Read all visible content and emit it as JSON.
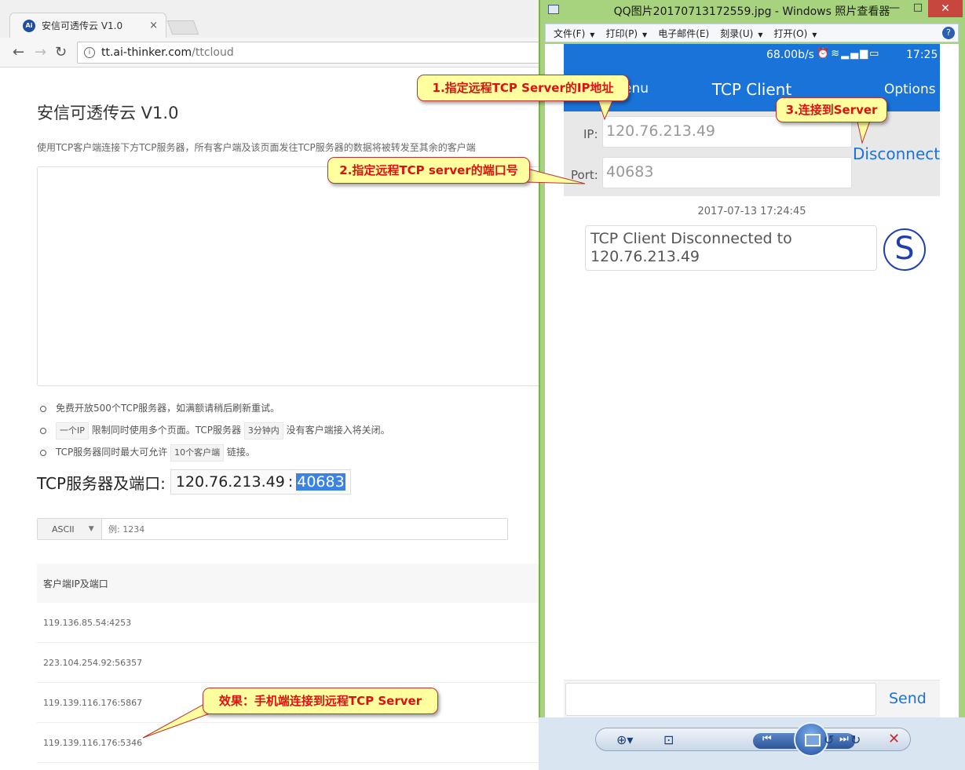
{
  "browser": {
    "tab_title": "安信可透传云 V1.0",
    "tab_icon": "ai-thinker-logo",
    "tab_close": "×",
    "url_domain": "tt.ai-thinker.com",
    "url_path": "/ttcloud"
  },
  "page": {
    "title": "安信可透传云 V1.0",
    "description": "使用TCP客户端连接下方TCP服务器，所有客户端及该页面发往TCP服务器的数据将被转发至其余的客户端",
    "notes": [
      {
        "text": "免费开放500个TCP服务器，如满额请稍后刷新重试。"
      },
      {
        "pre": "",
        "code1": "一个IP",
        "mid": "限制同时使用多个页面。TCP服务器",
        "code2": "3分钟内",
        "post": "没有客户端接入将关闭。"
      },
      {
        "pre": "TCP服务器同时最大可允许",
        "code1": "10个客户端",
        "post": "链接。"
      }
    ],
    "server_label": "TCP服务器及端口:",
    "server_ip": "120.76.213.49",
    "server_sep": ":",
    "server_port": "40683",
    "mode_select": "ASCII",
    "send_placeholder": "例: 1234",
    "table_header": "客户端IP及端口",
    "clients": [
      "119.136.85.54:4253",
      "223.104.254.92:56357",
      "119.139.116.176:5867",
      "119.139.116.176:5346"
    ]
  },
  "viewer": {
    "window_title": "QQ图片20170713172559.jpg - Windows 照片查看器",
    "menu": [
      {
        "label": "文件(F)",
        "caret": true
      },
      {
        "label": "打印(P)",
        "caret": true
      },
      {
        "label": "电子邮件(E)",
        "caret": false
      },
      {
        "label": "刻录(U)",
        "caret": true
      },
      {
        "label": "打开(O)",
        "caret": true
      }
    ],
    "help": "?"
  },
  "phone": {
    "net_speed": "68.00b/s",
    "time": "17:25",
    "menu_label": "enu",
    "app_title": "TCP Client",
    "options_label": "Options",
    "ip_label": "IP:",
    "ip_value": "120.76.213.49",
    "port_label": "Port:",
    "port_value": "40683",
    "connect_button": "Disconnect",
    "chat_date": "2017-07-13 17:24:45",
    "message": "TCP Client Disconnected to 120.76.213.49",
    "avatar_letter": "S",
    "send_button": "Send"
  },
  "callouts": {
    "c1": "1.指定远程TCP Server的IP地址",
    "c2": "2.指定远程TCP server的端口号",
    "c3": "3.连接到Server",
    "c4": "效果：手机端连接到远程TCP Server"
  },
  "colors": {
    "phone_accent": "#1a73d9",
    "callout_fill": "#ffffa0",
    "callout_text": "#dd1111",
    "viewer_frame": "#a8d37e",
    "port_highlight": "#3b82e6"
  }
}
